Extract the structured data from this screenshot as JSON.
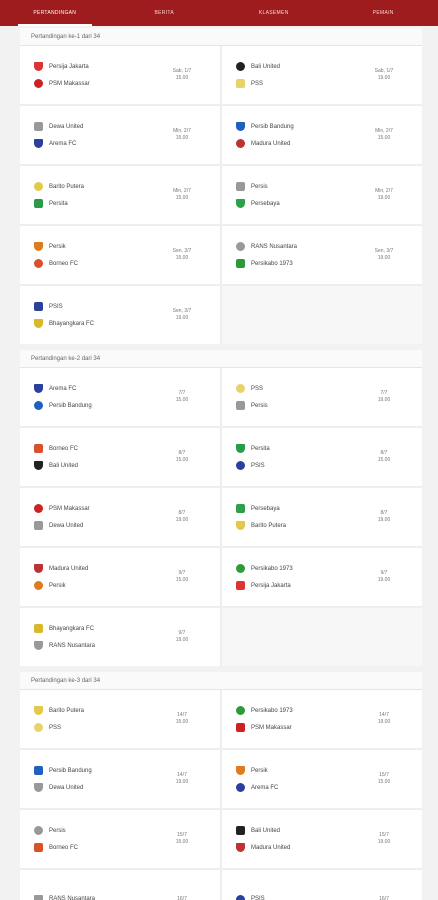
{
  "tabs": [
    "PERTANDINGAN",
    "BERITA",
    "KLASEMEN",
    "PEMAIN"
  ],
  "active_tab": 0,
  "rounds": [
    {
      "title": "Pertandingan ke-1 dari 34",
      "matches": [
        {
          "home": "Persija Jakarta",
          "away": "PSM Makassar",
          "date": "Sab, 1/7",
          "time": "15.00",
          "home_color": "#d33",
          "away_color": "#c22"
        },
        {
          "home": "Bali United",
          "away": "PSS",
          "date": "Sab, 1/7",
          "time": "19.00",
          "home_color": "#222",
          "away_color": "#e8d26a"
        },
        {
          "home": "Dewa United",
          "away": "Arema FC",
          "date": "Min, 2/7",
          "time": "15.00",
          "home_color": "#999",
          "away_color": "#2b3f9e"
        },
        {
          "home": "Persib Bandung",
          "away": "Madura United",
          "date": "Min, 2/7",
          "time": "15.00",
          "home_color": "#1f5fbf",
          "away_color": "#b33"
        },
        {
          "home": "Barito Putera",
          "away": "Persita",
          "date": "Min, 2/7",
          "time": "15.00",
          "home_color": "#e3c84a",
          "away_color": "#2a9a4a"
        },
        {
          "home": "Persis",
          "away": "Persebaya",
          "date": "Min, 2/7",
          "time": "19.00",
          "home_color": "#999",
          "away_color": "#2ea04a"
        },
        {
          "home": "Persik",
          "away": "Borneo FC",
          "date": "Sen, 3/7",
          "time": "15.00",
          "home_color": "#e07a1f",
          "away_color": "#d9502a"
        },
        {
          "home": "RANS Nusantara",
          "away": "Persikabo 1973",
          "date": "Sen, 3/7",
          "time": "19.00",
          "home_color": "#999",
          "away_color": "#2e9a3a"
        },
        {
          "home": "PSIS",
          "away": "Bhayangkara FC",
          "date": "Sen, 3/7",
          "time": "19.00",
          "home_color": "#2b3f9e",
          "away_color": "#d9b92a"
        }
      ]
    },
    {
      "title": "Pertandingan ke-2 dari 34",
      "matches": [
        {
          "home": "Arema FC",
          "away": "Persib Bandung",
          "date": "7/7",
          "time": "15.00",
          "home_color": "#2b3f9e",
          "away_color": "#1f5fbf"
        },
        {
          "home": "PSS",
          "away": "Persis",
          "date": "7/7",
          "time": "19.00",
          "home_color": "#e8d26a",
          "away_color": "#999"
        },
        {
          "home": "Borneo FC",
          "away": "Bali United",
          "date": "8/7",
          "time": "15.00",
          "home_color": "#d9502a",
          "away_color": "#222"
        },
        {
          "home": "Persita",
          "away": "PSIS",
          "date": "8/7",
          "time": "15.00",
          "home_color": "#2a9a4a",
          "away_color": "#2b3f9e"
        },
        {
          "home": "PSM Makassar",
          "away": "Dewa United",
          "date": "8/7",
          "time": "19.00",
          "home_color": "#c22",
          "away_color": "#999"
        },
        {
          "home": "Persebaya",
          "away": "Barito Putera",
          "date": "8/7",
          "time": "19.00",
          "home_color": "#2ea04a",
          "away_color": "#e3c84a"
        },
        {
          "home": "Madura United",
          "away": "Persik",
          "date": "9/7",
          "time": "15.00",
          "home_color": "#b33",
          "away_color": "#e07a1f"
        },
        {
          "home": "Persikabo 1973",
          "away": "Persija Jakarta",
          "date": "9/7",
          "time": "19.00",
          "home_color": "#2e9a3a",
          "away_color": "#d33"
        },
        {
          "home": "Bhayangkara FC",
          "away": "RANS Nusantara",
          "date": "9/7",
          "time": "19.00",
          "home_color": "#d9b92a",
          "away_color": "#999"
        }
      ]
    },
    {
      "title": "Pertandingan ke-3 dari 34",
      "matches": [
        {
          "home": "Barito Putera",
          "away": "PSS",
          "date": "14/7",
          "time": "15.00",
          "home_color": "#e3c84a",
          "away_color": "#e8d26a"
        },
        {
          "home": "Persikabo 1973",
          "away": "PSM Makassar",
          "date": "14/7",
          "time": "19.00",
          "home_color": "#2e9a3a",
          "away_color": "#c22"
        },
        {
          "home": "Persib Bandung",
          "away": "Dewa United",
          "date": "14/7",
          "time": "19.00",
          "home_color": "#1f5fbf",
          "away_color": "#999"
        },
        {
          "home": "Persik",
          "away": "Arema FC",
          "date": "15/7",
          "time": "15.00",
          "home_color": "#e07a1f",
          "away_color": "#2b3f9e"
        },
        {
          "home": "Persis",
          "away": "Borneo FC",
          "date": "15/7",
          "time": "15.00",
          "home_color": "#999",
          "away_color": "#d9502a"
        },
        {
          "home": "Bali United",
          "away": "Madura United",
          "date": "15/7",
          "time": "19.00",
          "home_color": "#222",
          "away_color": "#b33"
        },
        {
          "home": "RANS Nusantara",
          "away": "",
          "date": "16/7",
          "time": "",
          "home_color": "#999",
          "away_color": ""
        },
        {
          "home": "PSIS",
          "away": "",
          "date": "16/7",
          "time": "",
          "home_color": "#2b3f9e",
          "away_color": ""
        }
      ]
    }
  ]
}
